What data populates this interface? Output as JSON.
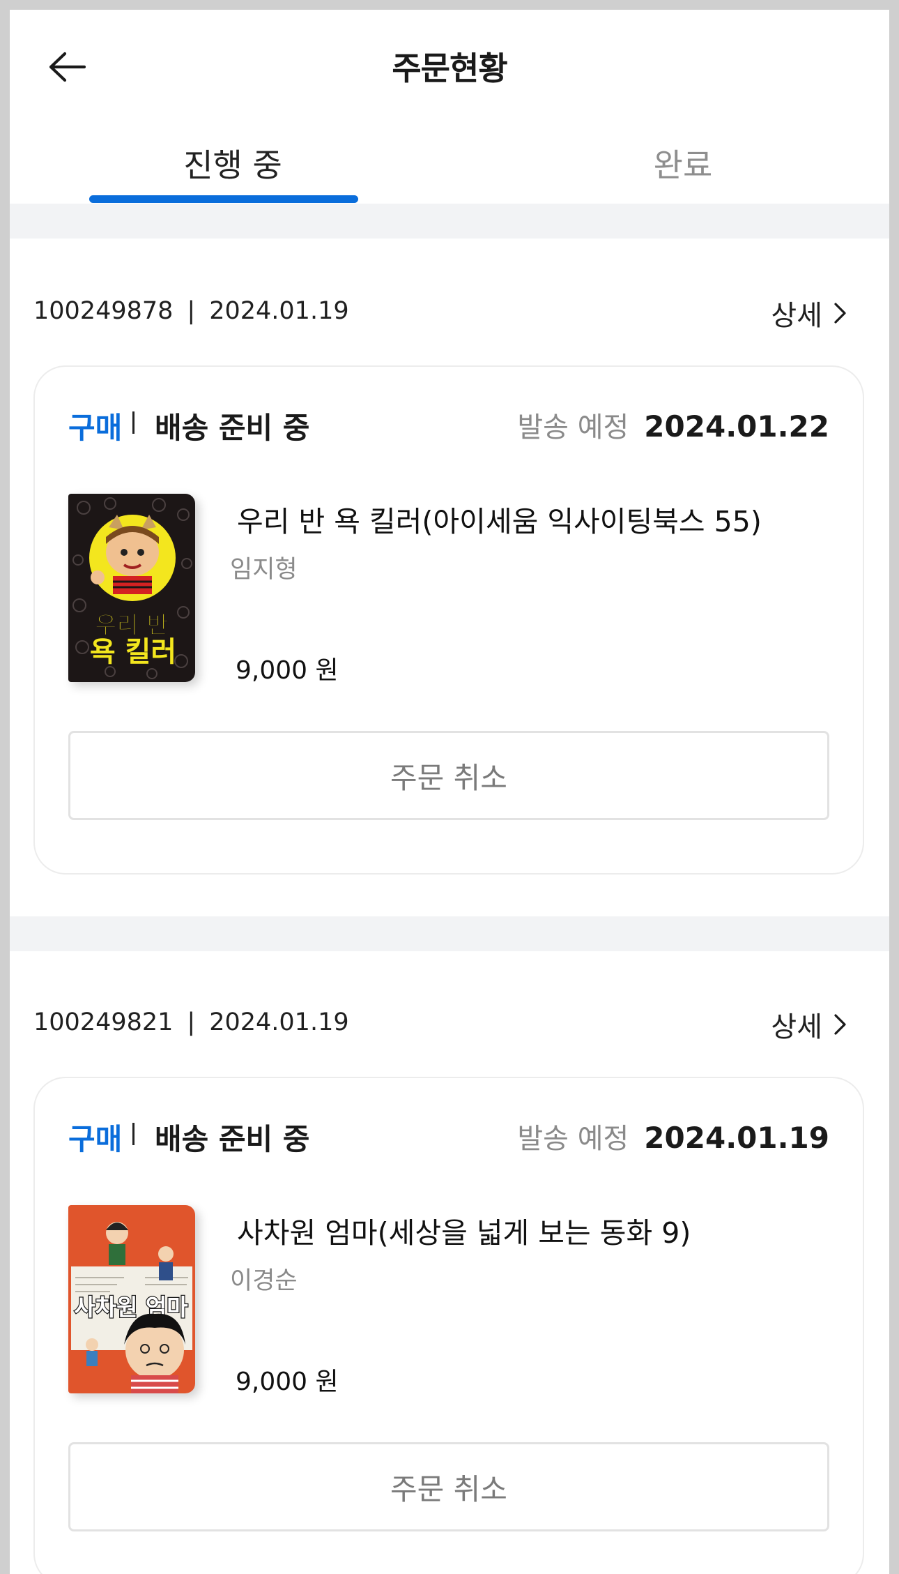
{
  "header": {
    "title": "주문현황"
  },
  "tabs": [
    {
      "label": "진행 중",
      "active": true
    },
    {
      "label": "완료",
      "active": false
    }
  ],
  "colors": {
    "accent": "#0a6ddb",
    "muted": "#8a8a8a",
    "band": "#f2f3f5"
  },
  "orders": [
    {
      "order_no": "100249878",
      "order_date": "2024.01.19",
      "detail_label": "상세",
      "type": "구매",
      "status": "배송 준비 중",
      "ship_label": "발송 예정",
      "ship_date": "2024.01.22",
      "book": {
        "title": "우리 반 욕 킬러(아이세움 익사이팅북스 55)",
        "author": "임지형",
        "price": "9,000 원",
        "cover_text_1": "우리 반",
        "cover_text_2": "욕 킬러"
      },
      "cancel_label": "주문 취소"
    },
    {
      "order_no": "100249821",
      "order_date": "2024.01.19",
      "detail_label": "상세",
      "type": "구매",
      "status": "배송 준비 중",
      "ship_label": "발송 예정",
      "ship_date": "2024.01.19",
      "book": {
        "title": "사차원 엄마(세상을 넓게 보는 동화 9)",
        "author": "이경순",
        "price": "9,000 원",
        "cover_text_1": "사차원 엄마"
      },
      "cancel_label": "주문 취소"
    }
  ]
}
